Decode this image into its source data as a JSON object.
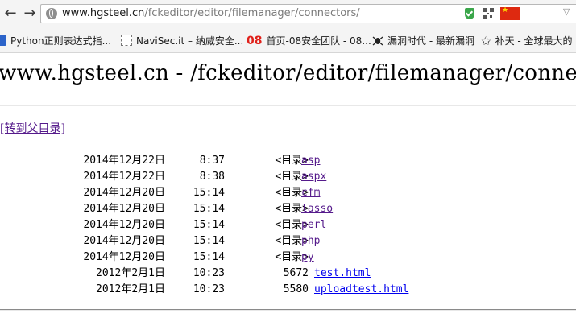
{
  "browser": {
    "url_host": "www.hgsteel.cn",
    "url_path": "/fckeditor/editor/filemanager/connectors/",
    "bookmarks": [
      {
        "label": "Python正则表达式指...",
        "icon": "blue-square-icon"
      },
      {
        "label": "NaviSec.it – 纳威安全...",
        "icon": "page-icon"
      },
      {
        "label": "首页-08安全团队 - 08...",
        "icon": "08-logo-icon"
      },
      {
        "label": "漏洞时代 - 最新漏洞",
        "icon": "bug-icon"
      },
      {
        "label": "补天 - 全球最大的",
        "icon": "star-icon"
      }
    ],
    "colors": {
      "chrome_bg": "#f4f4f4",
      "visited_link": "#551a8b",
      "link": "#0000ee"
    }
  },
  "page": {
    "heading": "www.hgsteel.cn - /fckeditor/editor/filemanager/connectors/",
    "parent_link": "[转到父目录]",
    "entries": [
      {
        "date": "2014年12月22日",
        "time": "8:37",
        "size": "<目录>",
        "name": "asp",
        "kind": "dir"
      },
      {
        "date": "2014年12月22日",
        "time": "8:38",
        "size": "<目录>",
        "name": "aspx",
        "kind": "dir"
      },
      {
        "date": "2014年12月20日",
        "time": "15:14",
        "size": "<目录>",
        "name": "cfm",
        "kind": "dir"
      },
      {
        "date": "2014年12月20日",
        "time": "15:14",
        "size": "<目录>",
        "name": "lasso",
        "kind": "dir"
      },
      {
        "date": "2014年12月20日",
        "time": "15:14",
        "size": "<目录>",
        "name": "perl",
        "kind": "dir"
      },
      {
        "date": "2014年12月20日",
        "time": "15:14",
        "size": "<目录>",
        "name": "php",
        "kind": "dir"
      },
      {
        "date": "2014年12月20日",
        "time": "15:14",
        "size": "<目录>",
        "name": "py",
        "kind": "dir"
      },
      {
        "date": "2012年2月1日",
        "time": "10:23",
        "size": "5672",
        "name": "test.html",
        "kind": "file"
      },
      {
        "date": "2012年2月1日",
        "time": "10:23",
        "size": "5580",
        "name": "uploadtest.html",
        "kind": "file"
      }
    ]
  }
}
